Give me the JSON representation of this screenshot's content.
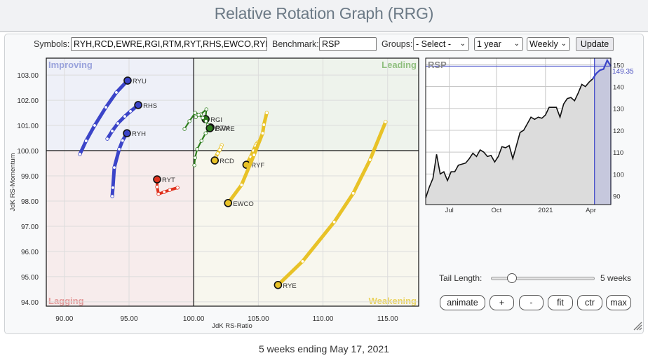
{
  "header": {
    "title": "Relative Rotation Graph (RRG)"
  },
  "toolbar": {
    "symbols_label": "Symbols:",
    "symbols_value": "RYH,RCD,EWRE,RGI,RTM,RYT,RHS,EWCO,RYF,",
    "benchmark_label": "Benchmark:",
    "benchmark_value": "RSP",
    "groups_label": "Groups:",
    "groups_value": "- Select -",
    "period_value": "1 year",
    "interval_value": "Weekly",
    "update_label": "Update"
  },
  "controls": {
    "tail_length_label": "Tail Length:",
    "tail_length_value": "5 weeks",
    "tail_length_fraction": 0.17,
    "buttons": [
      "animate",
      "+",
      "-",
      "fit",
      "ctr",
      "max"
    ]
  },
  "footer": {
    "caption": "5 weeks ending May 17, 2021"
  },
  "chart_data": [
    {
      "type": "scatter",
      "title": "Relative Rotation Graph",
      "xlabel": "JdK RS-Ratio",
      "ylabel": "JdK RS-Momentum",
      "xlim": [
        88.6,
        117.4
      ],
      "ylim": [
        93.83,
        103.67
      ],
      "x_ticks": [
        "90.00",
        "95.00",
        "100.00",
        "105.00",
        "110.00",
        "115.00"
      ],
      "x_tick_values": [
        90,
        95,
        100,
        105,
        110,
        115
      ],
      "y_ticks": [
        "103.00",
        "102.00",
        "101.00",
        "100.00",
        "99.00",
        "98.00",
        "97.00",
        "96.00",
        "95.00",
        "94.00"
      ],
      "y_tick_values": [
        103,
        102,
        101,
        100,
        99,
        98,
        97,
        96,
        95,
        94
      ],
      "center": [
        100,
        100
      ],
      "grid": true,
      "quadrants": [
        {
          "name": "Improving",
          "position": "top-left",
          "bg": "#eef0f8",
          "label_color": "#9aa3dc"
        },
        {
          "name": "Leading",
          "position": "top-right",
          "bg": "#eef3ec",
          "label_color": "#8fbf7e"
        },
        {
          "name": "Lagging",
          "position": "bottom-left",
          "bg": "#f7ecec",
          "label_color": "#e39a9a"
        },
        {
          "name": "Weakening",
          "position": "bottom-right",
          "bg": "#f8f7ee",
          "label_color": "#ead35e"
        }
      ],
      "series": [
        {
          "name": "RYU",
          "color": "#3b44c8",
          "tail": [
            [
              91.2,
              99.86
            ],
            [
              91.68,
              100.39
            ],
            [
              92.34,
              101.0
            ],
            [
              93.21,
              101.72
            ],
            [
              94.02,
              102.31
            ],
            [
              94.89,
              102.78
            ]
          ]
        },
        {
          "name": "RHS",
          "color": "#3b44c8",
          "tail": [
            [
              93.32,
              100.47
            ],
            [
              93.7,
              100.78
            ],
            [
              94.13,
              101.08
            ],
            [
              94.67,
              101.36
            ],
            [
              95.11,
              101.56
            ],
            [
              95.71,
              101.81
            ]
          ]
        },
        {
          "name": "RYH",
          "color": "#3b44c8",
          "tail": [
            [
              93.7,
              98.19
            ],
            [
              93.75,
              98.53
            ],
            [
              93.86,
              99.33
            ],
            [
              94.24,
              100.06
            ],
            [
              94.5,
              100.4
            ],
            [
              94.84,
              100.69
            ]
          ]
        },
        {
          "name": "RYT",
          "color": "#e0321e",
          "tail": [
            [
              98.75,
              98.53
            ],
            [
              98.15,
              98.44
            ],
            [
              97.72,
              98.36
            ],
            [
              97.28,
              98.28
            ],
            [
              97.17,
              98.56
            ],
            [
              97.17,
              98.86
            ]
          ]
        },
        {
          "name": "RGI",
          "color": "#2e7d1e",
          "tail": [
            [
              99.29,
              100.86
            ],
            [
              99.67,
              101.17
            ],
            [
              100.11,
              101.5
            ],
            [
              100.54,
              101.44
            ],
            [
              100.98,
              101.64
            ],
            [
              100.92,
              101.25
            ]
          ]
        },
        {
          "name": "RTM",
          "color": "#2e7d1e",
          "tail": [
            [
              100.05,
              99.42
            ],
            [
              100.11,
              99.72
            ],
            [
              100.27,
              100.06
            ],
            [
              100.6,
              100.39
            ],
            [
              100.92,
              100.69
            ],
            [
              101.3,
              100.92
            ]
          ]
        },
        {
          "name": "EWRE",
          "color": "#2e7d1e",
          "tail": [
            [
              100.16,
              101.33
            ],
            [
              100.38,
              101.42
            ],
            [
              100.7,
              101.3
            ],
            [
              100.95,
              101.17
            ],
            [
              101.1,
              101.02
            ],
            [
              101.25,
              100.89
            ]
          ]
        },
        {
          "name": "RCD",
          "color": "#e8c227",
          "tail": [
            [
              102.17,
              100.22
            ],
            [
              102.12,
              100.14
            ],
            [
              102.01,
              100.03
            ],
            [
              101.85,
              99.89
            ],
            [
              101.7,
              99.75
            ],
            [
              101.63,
              99.61
            ]
          ]
        },
        {
          "name": "RYF",
          "color": "#e8c227",
          "tail": [
            [
              104.95,
              100.33
            ],
            [
              104.84,
              100.25
            ],
            [
              104.78,
              100.19
            ],
            [
              104.62,
              100.0
            ],
            [
              104.4,
              99.75
            ],
            [
              104.08,
              99.44
            ]
          ]
        },
        {
          "name": "EWCO",
          "color": "#e8c227",
          "tail": [
            [
              105.65,
              101.5
            ],
            [
              105.43,
              101.03
            ],
            [
              105.33,
              100.69
            ],
            [
              104.67,
              99.83
            ],
            [
              103.7,
              98.64
            ],
            [
              102.66,
              97.92
            ]
          ]
        },
        {
          "name": "RYE",
          "color": "#e8c227",
          "tail": [
            [
              114.84,
              101.14
            ],
            [
              113.64,
              99.64
            ],
            [
              112.34,
              98.31
            ],
            [
              110.87,
              97.17
            ],
            [
              108.42,
              95.61
            ],
            [
              106.52,
              94.67
            ]
          ]
        }
      ]
    },
    {
      "type": "area",
      "title": "RSP",
      "last_value": "149.35",
      "ylim": [
        86,
        153
      ],
      "y_ticks": [
        "90",
        "100",
        "110",
        "120",
        "130",
        "140",
        "150"
      ],
      "y_tick_values": [
        90,
        100,
        110,
        120,
        130,
        140,
        150
      ],
      "x_ticks": [
        "Jul",
        "Oct",
        "2021",
        "Apr"
      ],
      "x_tick_indices": [
        6.5,
        19.5,
        33,
        45.5
      ],
      "highlight_from_index": 46.5,
      "values": [
        89,
        94,
        98,
        109,
        100,
        101,
        97,
        101,
        101,
        104,
        104.5,
        105,
        107,
        109.5,
        108,
        111,
        110,
        108,
        108.5,
        105.5,
        108,
        112.5,
        112,
        113,
        107,
        113,
        119,
        120,
        123,
        126,
        125,
        126,
        125.5,
        127,
        130.5,
        130.5,
        130.5,
        126,
        132,
        134.5,
        135,
        133.5,
        137,
        141,
        140,
        142,
        143.5,
        146,
        147.5,
        148,
        152,
        149.35
      ]
    }
  ]
}
